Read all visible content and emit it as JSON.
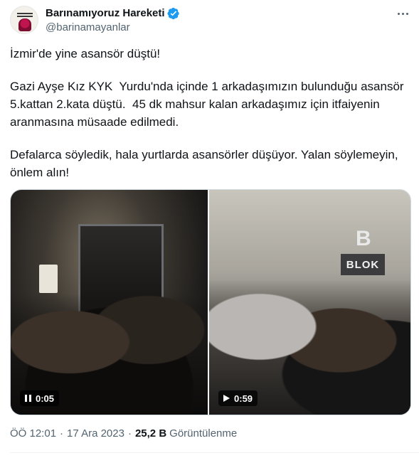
{
  "author": {
    "display_name": "Barınamıyoruz Hareketi",
    "handle": "@barinamayanlar",
    "verified_color": "#1d9bf0"
  },
  "tweet": {
    "paragraphs": [
      "İzmir'de yine asansör düştü!",
      "Gazi Ayşe Kız KYK  Yurdu'nda içinde 1 arkadaşımızın bulunduğu asansör 5.kattan 2.kata düştü.  45 dk mahsur kalan arkadaşımız için itfaiyenin aranmasına müsaade edilmedi.",
      "Defalarca söyledik, hala yurtlarda asansörler düşüyor. Yalan söylemeyin, önlem alın!"
    ]
  },
  "media": [
    {
      "state_icon": "pause-icon",
      "duration": "0:05"
    },
    {
      "state_icon": "play-icon",
      "duration": "0:59",
      "scene_letter": "B",
      "scene_sign": "BLOK"
    }
  ],
  "meta": {
    "time": "ÖÖ 12:01",
    "separator": "·",
    "date": "17 Ara 2023",
    "views_count": "25,2 B",
    "views_label": "Görüntülenme"
  }
}
